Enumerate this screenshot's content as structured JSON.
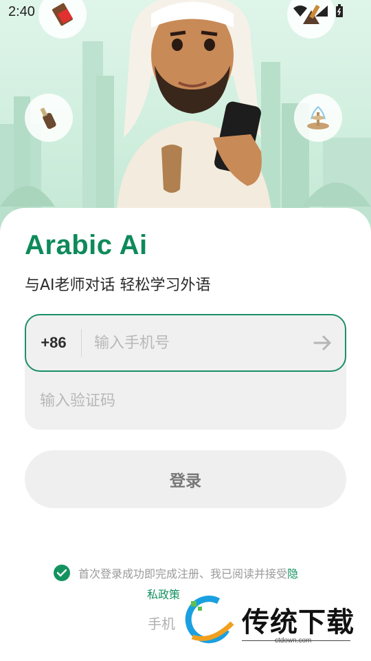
{
  "status": {
    "time": "2:40"
  },
  "icons": {
    "chocolate": "chocolate-icon",
    "drink": "drink-bottle-icon",
    "fountain": "fountain-icon",
    "incense": "incense-burner-icon",
    "wifi": "wifi-icon",
    "signal": "signal-icon",
    "battery": "battery-icon"
  },
  "app": {
    "title": "Arabic Ai",
    "subtitle": "与AI老师对话 轻松学习外语"
  },
  "form": {
    "country_code": "+86",
    "phone_placeholder": "输入手机号",
    "code_placeholder": "输入验证码",
    "login_label": "登录"
  },
  "agreement": {
    "text": "首次登录成功即完成注册、我已阅读并接受",
    "link_part1": "隐",
    "link_part2": "私政策"
  },
  "alt_login": "手机",
  "watermark": {
    "name": "传统下载",
    "url": "ctdown.com"
  },
  "colors": {
    "brand_green": "#0e8a5a",
    "input_border": "#1a8f66",
    "check_green": "#13925f"
  }
}
